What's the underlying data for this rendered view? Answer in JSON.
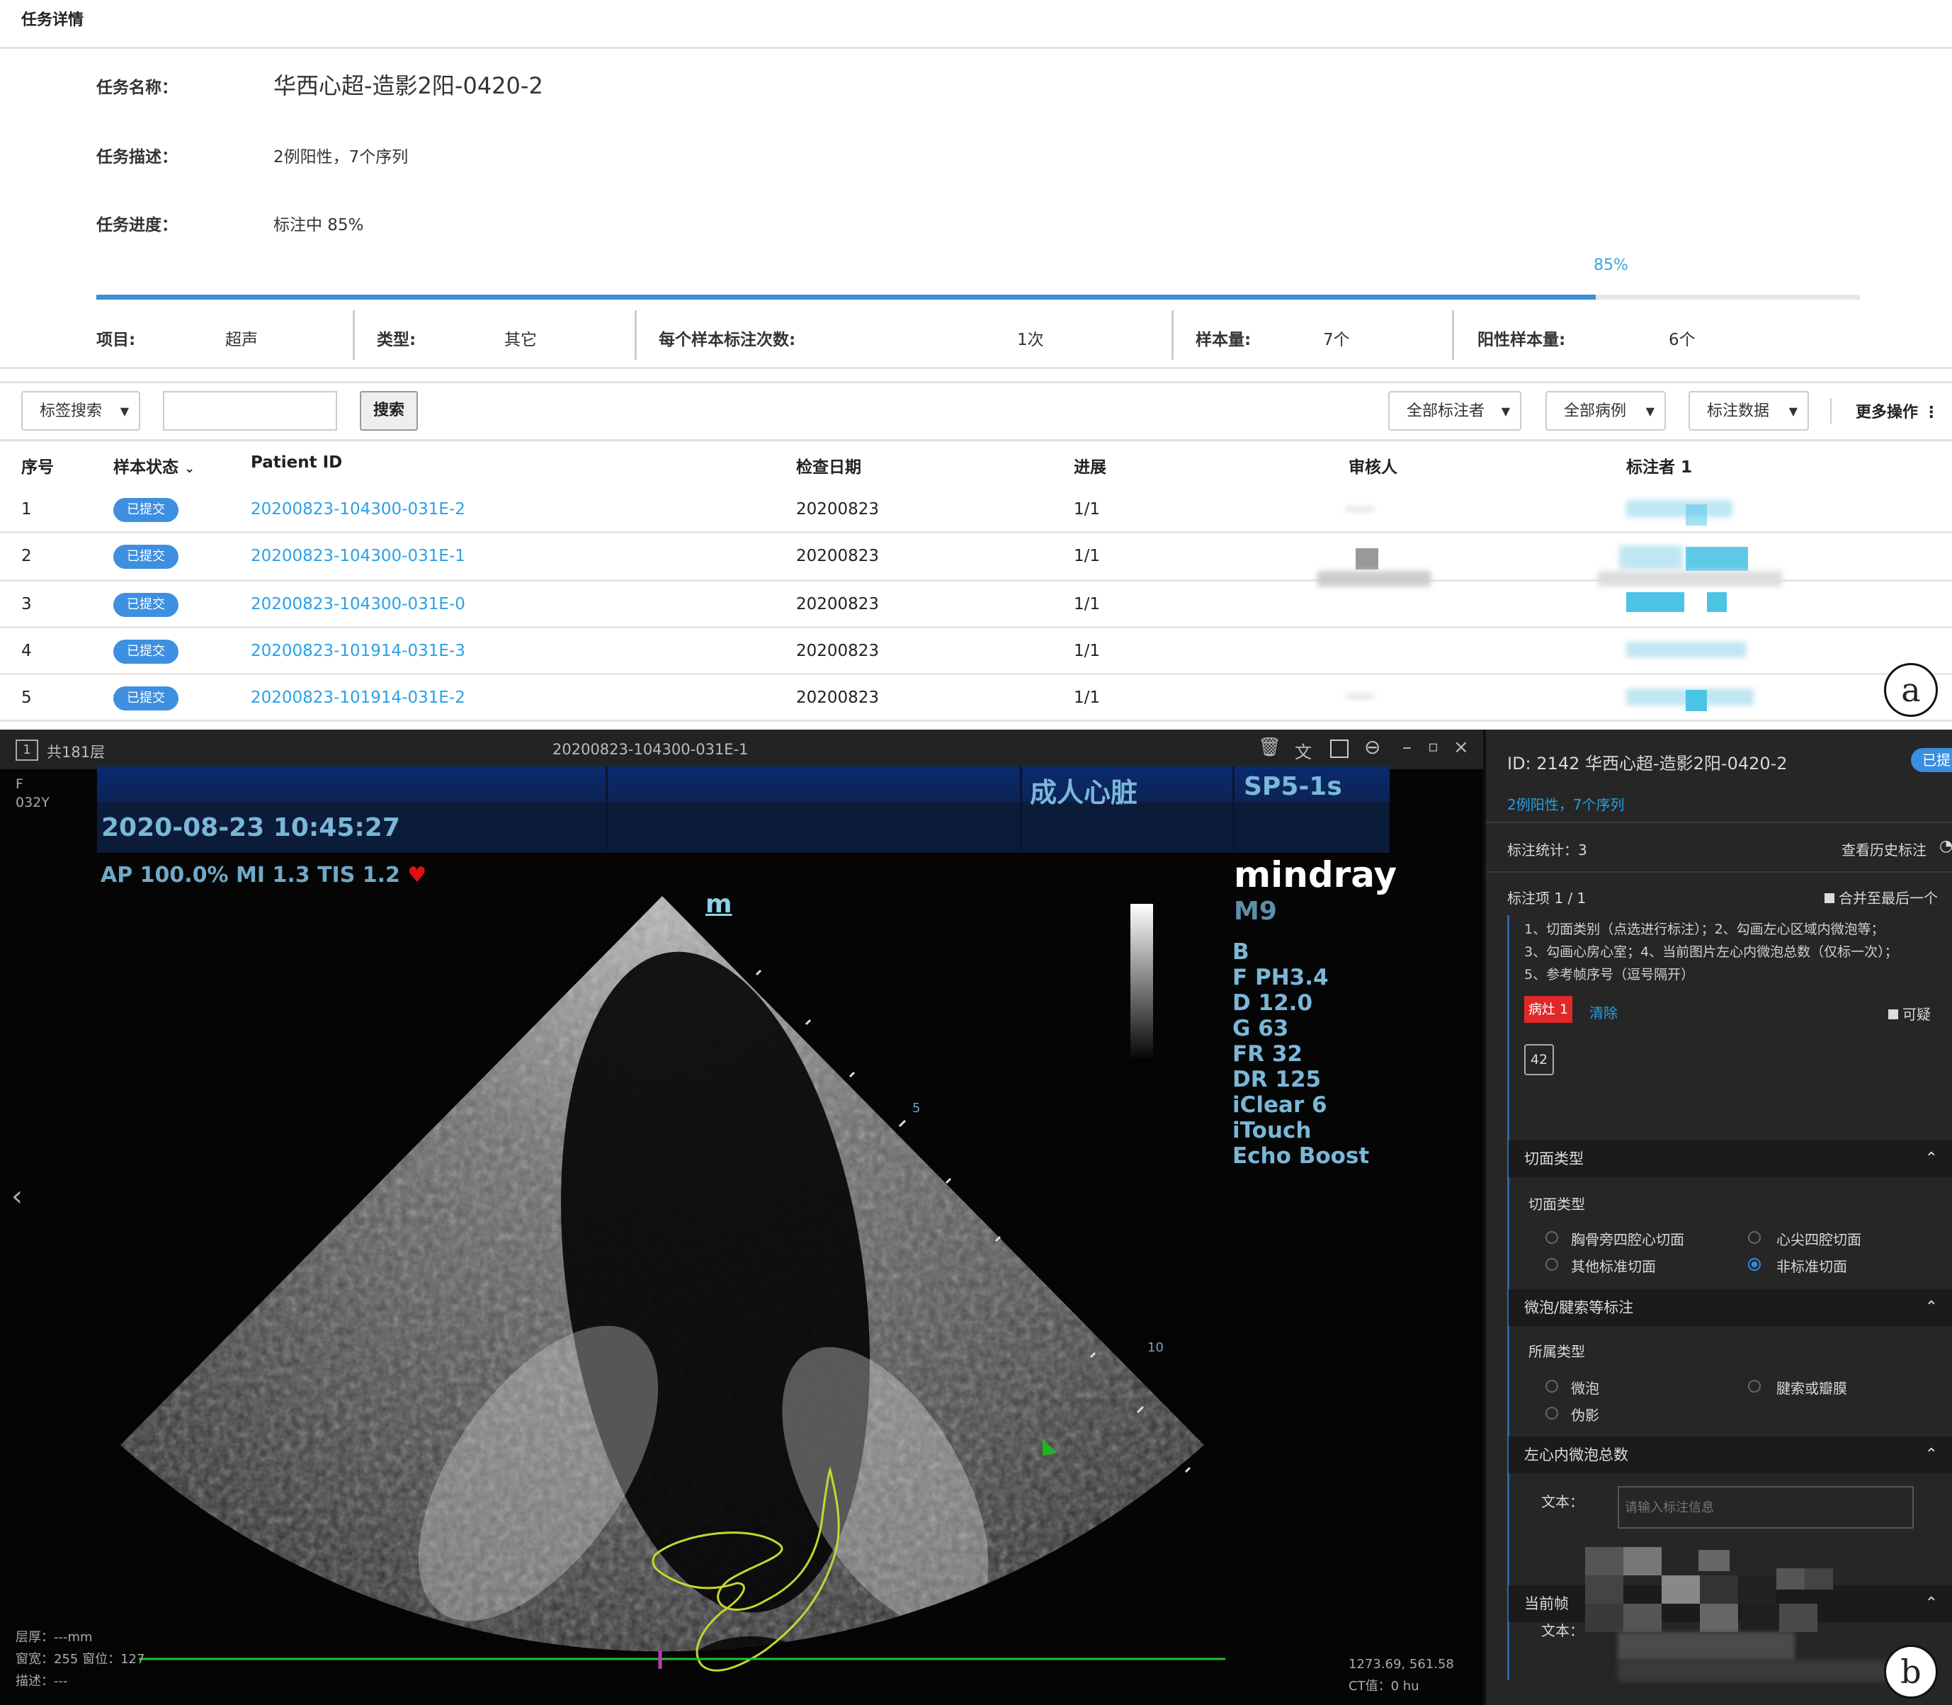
{
  "panel_a": {
    "header_title": "任务详情",
    "task_name_label": "任务名称：",
    "task_name": "华西心超-造影2阳-0420-2",
    "task_desc_label": "任务描述：",
    "task_desc": "2例阳性，7个序列",
    "task_progress_label": "任务进度：",
    "task_progress": "标注中 85%",
    "progress_percent_text": "85%",
    "progress_fraction": 0.85,
    "stats": [
      {
        "label": "项目:",
        "value": "超声"
      },
      {
        "label": "类型:",
        "value": "其它"
      },
      {
        "label": "每个样本标注次数:",
        "value": "1次"
      },
      {
        "label": "样本量:",
        "value": "7个"
      },
      {
        "label": "阳性样本量:",
        "value": "6个"
      }
    ],
    "toolbar": {
      "search_type": "标签搜索",
      "search_value": "",
      "search_button": "搜索",
      "filter_annotators": "全部标注者",
      "filter_cases": "全部病例",
      "filter_data": "标注数据",
      "more_actions": "更多操作"
    },
    "table": {
      "headers": [
        "序号",
        "样本状态",
        "Patient ID",
        "检查日期",
        "进展",
        "审核人",
        "标注者 1"
      ],
      "rows": [
        {
          "no": "1",
          "status": "已提交",
          "patient_id": "20200823-104300-031E-2",
          "date": "20200823",
          "progress": "1/1"
        },
        {
          "no": "2",
          "status": "已提交",
          "patient_id": "20200823-104300-031E-1",
          "date": "20200823",
          "progress": "1/1"
        },
        {
          "no": "3",
          "status": "已提交",
          "patient_id": "20200823-104300-031E-0",
          "date": "20200823",
          "progress": "1/1"
        },
        {
          "no": "4",
          "status": "已提交",
          "patient_id": "20200823-101914-031E-3",
          "date": "20200823",
          "progress": "1/1"
        },
        {
          "no": "5",
          "status": "已提交",
          "patient_id": "20200823-101914-031E-2",
          "date": "20200823",
          "progress": "1/1"
        }
      ]
    },
    "panel_label": "a"
  },
  "panel_b": {
    "viewer": {
      "layer_index": "1",
      "layer_count": "共181层",
      "title": "20200823-104300-031E-1",
      "patient_sex": "F",
      "patient_age": "032Y",
      "us_datetime": "2020-08-23 10:45:27",
      "us_mode": "成人心脏",
      "us_probe": "SP5-1s",
      "us_power": "AP 100.0%  MI 1.3 TIS 1.2",
      "brand": "mindray",
      "model": "M9",
      "marker_m": "m",
      "params": [
        "B",
        "F PH3.4",
        "D 12.0",
        "G 63",
        "FR 32",
        "DR 125",
        "iClear 6",
        "iTouch",
        "Echo Boost"
      ],
      "depth_5": "5",
      "depth_10": "10",
      "bottom_left": [
        "层厚：---mm",
        "窗宽：255 窗位：127",
        "描述：---"
      ],
      "bottom_right": [
        "1273.69, 561.58",
        "CT值：0 hu"
      ]
    },
    "side": {
      "id_line": "ID: 2142 华西心超-造影2阳-0420-2",
      "status_badge": "已提",
      "desc": "2例阳性，7个序列",
      "stats_label": "标注统计：3",
      "history_link": "查看历史标注",
      "item_label": "标注项 1 / 1",
      "merge_label": "合并至最后一个",
      "instructions": [
        "1、切面类别（点选进行标注）；2、勾画左心区域内微泡等；",
        "3、勾画心房心室；4、当前图片左心内微泡总数（仅标一次）；",
        "5、参考帧序号（逗号隔开）"
      ],
      "lesion_tag": "病灶 1",
      "clear_link": "清除",
      "doubtful_label": "可疑",
      "frame_number": "42",
      "section1_title": "切面类型",
      "section1_field": "切面类型",
      "section1_options": [
        "胸骨旁四腔心切面",
        "心尖四腔切面",
        "其他标准切面",
        "非标准切面"
      ],
      "section1_selected": "非标准切面",
      "section2_title": "微泡/腱索等标注",
      "section2_field": "所属类型",
      "section2_options": [
        "微泡",
        "腱索或瓣膜",
        "伪影"
      ],
      "section3_title": "左心内微泡总数",
      "section3_field": "文本：",
      "section3_placeholder": "请输入标注信息",
      "section4_title": "当前帧",
      "section4_field": "文本："
    },
    "panel_label": "b"
  }
}
